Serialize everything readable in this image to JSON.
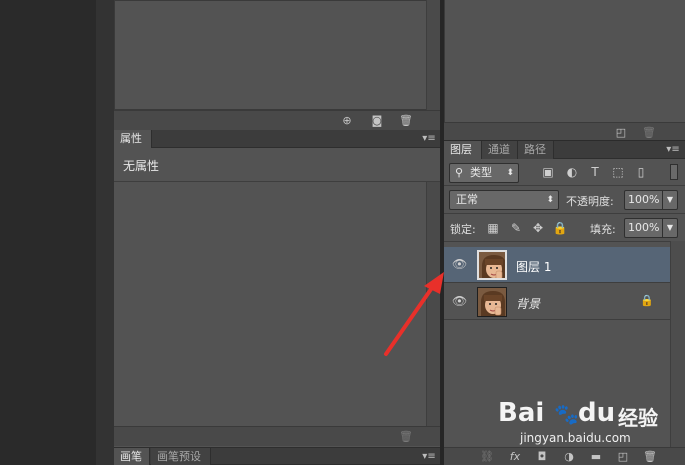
{
  "properties_panel": {
    "tab_label": "属性",
    "content_text": "无属性"
  },
  "brush_panel": {
    "tabs": [
      "画笔",
      "画笔预设"
    ]
  },
  "layers_panel": {
    "tabs": [
      "图层",
      "通道",
      "路径"
    ],
    "filter": {
      "label": "类型",
      "icon": "search-icon"
    },
    "blend_mode": "正常",
    "opacity_label": "不透明度:",
    "opacity_value": "100%",
    "lock_label": "锁定:",
    "fill_label": "填充:",
    "fill_value": "100%",
    "layers": [
      {
        "name": "图层 1",
        "selected": true,
        "locked": false
      },
      {
        "name": "背景",
        "selected": false,
        "locked": true
      }
    ],
    "footer_icons": [
      "link-icon",
      "fx-icon",
      "mask-icon",
      "adjustment-icon",
      "folder-icon",
      "new-layer-icon",
      "trash-icon"
    ]
  },
  "watermark": {
    "brand": "Bai",
    "brand2": "du",
    "cn": "经验",
    "url": "jingyan.baidu.com"
  },
  "colors": {
    "selected_layer": "#566576",
    "panel_bg": "#535353",
    "arrow": "#e8302a"
  }
}
